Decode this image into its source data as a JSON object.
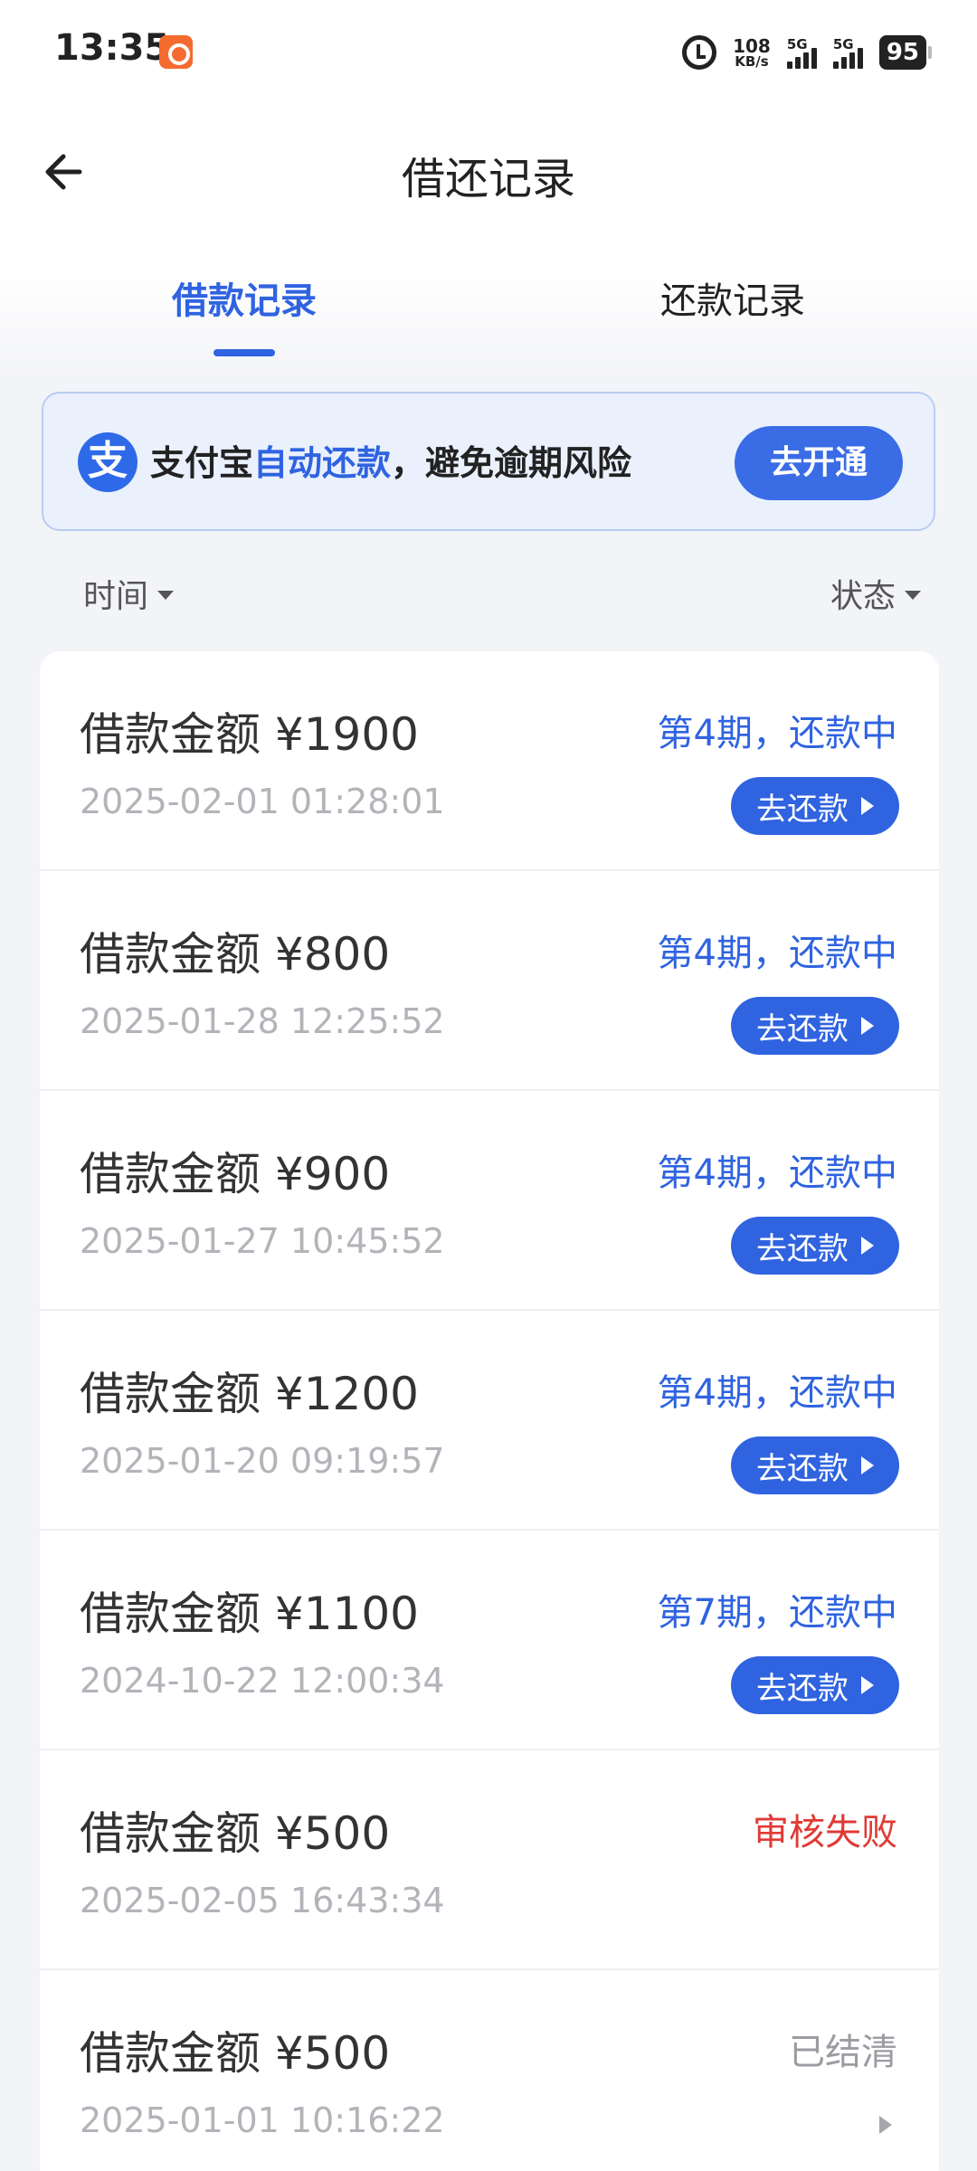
{
  "status_bar": {
    "time": "13:35",
    "net_speed": "108",
    "net_unit": "KB/s",
    "signal1_label": "5G",
    "signal2_label": "5G",
    "battery": "95",
    "icons": [
      "app-notification-icon",
      "alarm-icon",
      "signal-icon",
      "battery-icon"
    ]
  },
  "header": {
    "title": "借还记录",
    "back_icon": "arrow-left-icon"
  },
  "tabs": [
    {
      "label": "借款记录",
      "active": true
    },
    {
      "label": "还款记录",
      "active": false
    }
  ],
  "banner": {
    "icon_glyph": "支",
    "text_prefix": "支付宝",
    "text_highlight": "自动还款",
    "text_suffix": "，避免逾期风险",
    "button_label": "去开通"
  },
  "filters": {
    "time_label": "时间",
    "status_label": "状态"
  },
  "records": [
    {
      "amount": "借款金额 ¥1900",
      "time": "2025-02-01 01:28:01",
      "status": "第4期，还款中",
      "status_color": "#2f63e0",
      "action": "去还款"
    },
    {
      "amount": "借款金额 ¥800",
      "time": "2025-01-28 12:25:52",
      "status": "第4期，还款中",
      "status_color": "#2f63e0",
      "action": "去还款"
    },
    {
      "amount": "借款金额 ¥900",
      "time": "2025-01-27 10:45:52",
      "status": "第4期，还款中",
      "status_color": "#2f63e0",
      "action": "去还款"
    },
    {
      "amount": "借款金额 ¥1200",
      "time": "2025-01-20 09:19:57",
      "status": "第4期，还款中",
      "status_color": "#2f63e0",
      "action": "去还款"
    },
    {
      "amount": "借款金额 ¥1100",
      "time": "2024-10-22 12:00:34",
      "status": "第7期，还款中",
      "status_color": "#2f63e0",
      "action": "去还款"
    },
    {
      "amount": "借款金额 ¥500",
      "time": "2025-02-05 16:43:34",
      "status": "审核失败",
      "status_color": "#e03a35"
    },
    {
      "amount": "借款金额 ¥500",
      "time": "2025-01-01 10:16:22",
      "status": "已结清",
      "status_color": "#9a9ca1"
    }
  ]
}
